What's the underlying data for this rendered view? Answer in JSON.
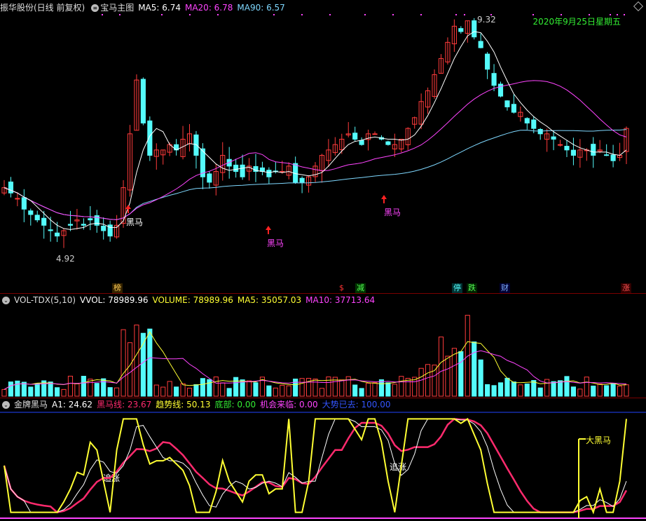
{
  "main": {
    "stock_name": "振华股份(日线 前复权)",
    "indicator_name": "宝马主图",
    "ma5": "MA5: 6.74",
    "ma20": "MA20: 6.78",
    "ma90": "MA90: 6.57",
    "high_label": "9.32",
    "low_label": "4.92",
    "date": "2020年9月25日星期五",
    "signals": [
      "黑马",
      "黑马",
      "黑马"
    ],
    "tags": [
      "榜",
      "$",
      "减",
      "停",
      "跌",
      "财",
      "涨"
    ]
  },
  "volume": {
    "title": "VOL-TDX(5,10)",
    "vvol": "VVOL: 78989.96",
    "volume": "VOLUME: 78989.96",
    "ma5": "MA5: 35057.03",
    "ma10": "MA10: 37713.64"
  },
  "indicator": {
    "title": "金牌黑马",
    "a1": "A1: 24.62",
    "heima": "黑马线: 23.67",
    "trend": "趋势线: 50.13",
    "bottom": "底部: 0.00",
    "chance": "机会来临: 0.00",
    "bigtrend": "大势已去: 100.00",
    "chase": [
      "追涨",
      "追涨"
    ],
    "big_horse": "大黑马"
  },
  "colors": {
    "up": "#ff3b3b",
    "down": "#54fcfc",
    "ma5": "#ffffff",
    "ma20": "#ff44ff",
    "ma90": "#7fd8ff",
    "trend": "#ffff33",
    "heima": "#ff2a6d",
    "date": "#33ee33"
  },
  "chart_data": {
    "type": "candlestick",
    "close": [
      6.2,
      6.1,
      6.0,
      5.8,
      5.7,
      5.6,
      5.5,
      5.4,
      5.3,
      5.4,
      5.5,
      5.6,
      5.5,
      5.6,
      5.5,
      5.4,
      5.3,
      5.5,
      6.2,
      7.2,
      8.2,
      7.4,
      6.8,
      6.9,
      6.9,
      7.0,
      6.9,
      7.1,
      7.2,
      6.8,
      6.4,
      6.3,
      6.5,
      6.8,
      6.6,
      6.5,
      6.4,
      6.6,
      6.5,
      6.5,
      6.4,
      6.5,
      6.5,
      6.6,
      6.3,
      6.3,
      6.4,
      6.6,
      6.8,
      6.9,
      7.0,
      7.1,
      7.2,
      7.1,
      7.0,
      7.2,
      7.2,
      7.1,
      7.0,
      7.0,
      7.1,
      7.3,
      7.5,
      7.8,
      8.0,
      8.3,
      8.6,
      8.9,
      9.2,
      9.1,
      9.3,
      9.0,
      8.8,
      8.4,
      8.1,
      7.9,
      7.7,
      7.6,
      7.6,
      7.4,
      7.3,
      7.2,
      7.2,
      7.1,
      7.0,
      6.9,
      6.8,
      6.9,
      6.9,
      6.8,
      6.9,
      6.8,
      6.7,
      6.8,
      7.3
    ]
  }
}
